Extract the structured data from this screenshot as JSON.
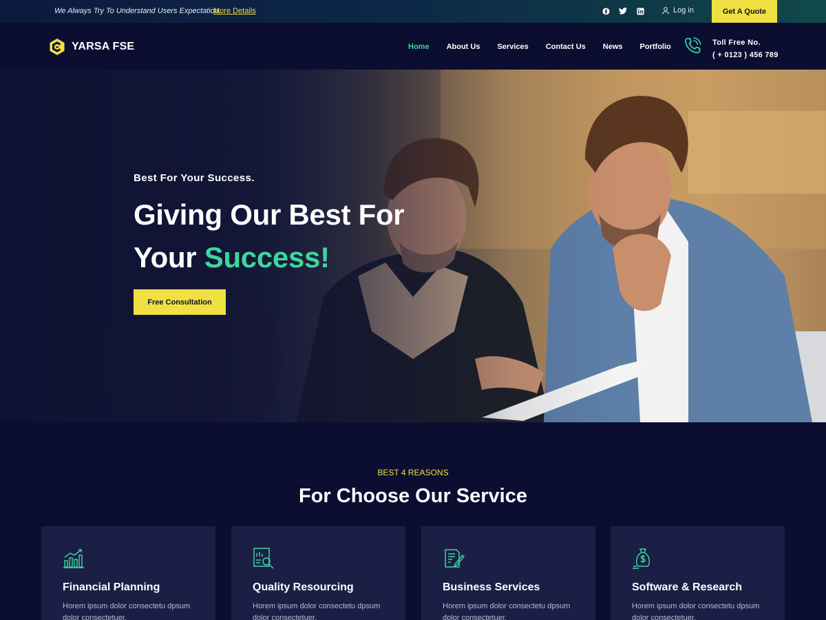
{
  "topbar": {
    "tagline": "We Always Try To Understand Users Expectation.",
    "more_link": "More Details",
    "social": [
      "facebook-icon",
      "twitter-icon",
      "linkedin-icon"
    ],
    "login": "Log in",
    "quote": "Get A Quote"
  },
  "header": {
    "logo_text": "YARSA FSE",
    "nav": [
      "Home",
      "About Us",
      "Services",
      "Contact Us",
      "News",
      "Portfolio"
    ],
    "active_nav": "Home",
    "toll_label": "Toll Free No.",
    "toll_number": "( + 0123 ) 456 789"
  },
  "hero": {
    "kicker": "Best For Your Success.",
    "title_line1": "Giving Our Best For",
    "title_line2_prefix": "Your ",
    "title_line2_accent": "Success!",
    "button": "Free Consultation"
  },
  "services": {
    "kicker": "BEST 4 REASONS",
    "title": "For Choose Our Service",
    "cards": [
      {
        "icon": "chart-growth-icon",
        "title": "Financial Planning",
        "text": "Horem ipsum dolor consectetu dpsum dolor consectetuer."
      },
      {
        "icon": "report-search-icon",
        "title": "Quality Resourcing",
        "text": "Horem ipsum dolor consectetu dpsum dolor consectetuer."
      },
      {
        "icon": "document-edit-icon",
        "title": "Business Services",
        "text": "Horem ipsum dolor consectetu dpsum dolor consectetuer."
      },
      {
        "icon": "money-bag-icon",
        "title": "Software & Research",
        "text": "Horem ipsum dolor consectetu dpsum dolor consectetuer."
      }
    ]
  },
  "colors": {
    "background": "#0b0e31",
    "accent_green": "#3dd69d",
    "accent_yellow": "#f0e142",
    "card": "#1b1f45"
  }
}
